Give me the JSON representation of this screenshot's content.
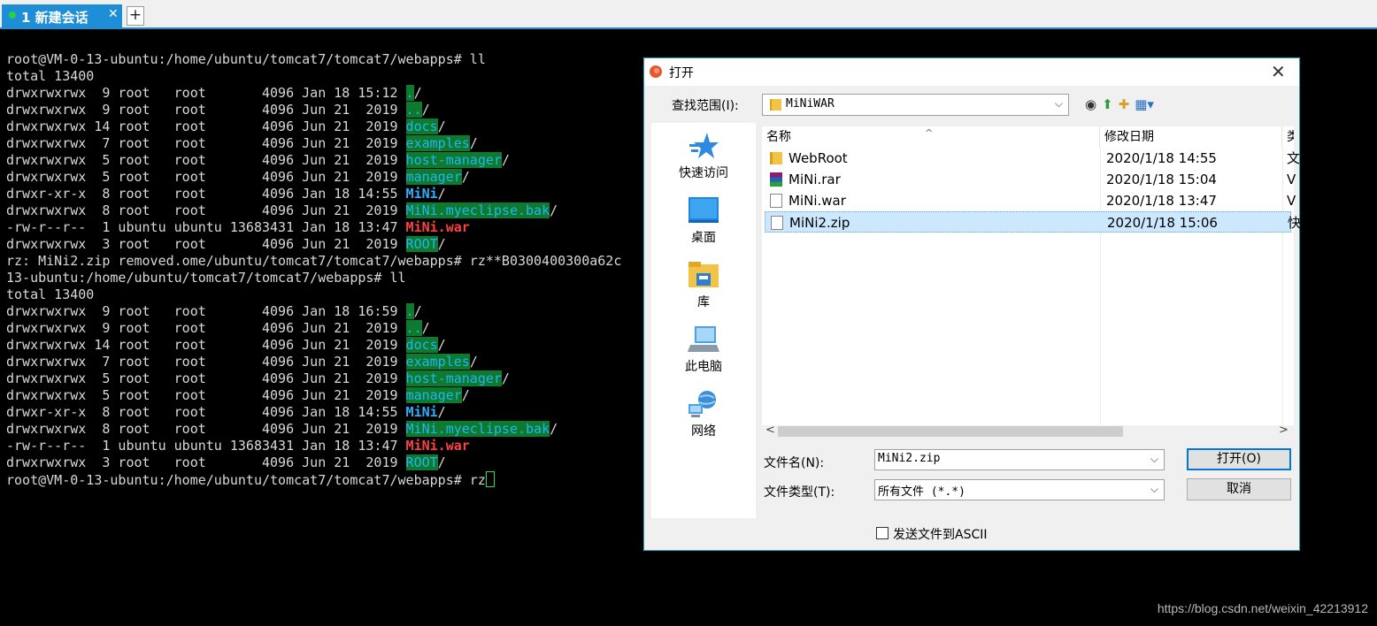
{
  "tabs": [
    {
      "label": "1 新建会话",
      "close": "✕"
    }
  ],
  "new_tab_label": "+",
  "terminal": {
    "lines": [
      {
        "parts": [
          {
            "t": "root@VM-0-13-ubuntu:/home/ubuntu/tomcat7/tomcat7/webapps# ll"
          }
        ]
      },
      {
        "parts": [
          {
            "t": "total 13400"
          }
        ]
      },
      {
        "parts": [
          {
            "t": "drwxrwxrwx  9 root   root       4096 Jan 18 15:12 "
          },
          {
            "t": ".",
            "c": "dirhl"
          },
          {
            "t": "/"
          }
        ]
      },
      {
        "parts": [
          {
            "t": "drwxrwxrwx  9 root   root       4096 Jun 21  2019 "
          },
          {
            "t": "..",
            "c": "dirhl"
          },
          {
            "t": "/"
          }
        ]
      },
      {
        "parts": [
          {
            "t": "drwxrwxrwx 14 root   root       4096 Jun 21  2019 "
          },
          {
            "t": "docs",
            "c": "dirhl"
          },
          {
            "t": "/"
          }
        ]
      },
      {
        "parts": [
          {
            "t": "drwxrwxrwx  7 root   root       4096 Jun 21  2019 "
          },
          {
            "t": "examples",
            "c": "dirhl"
          },
          {
            "t": "/"
          }
        ]
      },
      {
        "parts": [
          {
            "t": "drwxrwxrwx  5 root   root       4096 Jun 21  2019 "
          },
          {
            "t": "host-manager",
            "c": "dirhl"
          },
          {
            "t": "/"
          }
        ]
      },
      {
        "parts": [
          {
            "t": "drwxrwxrwx  5 root   root       4096 Jun 21  2019 "
          },
          {
            "t": "manager",
            "c": "dirhl"
          },
          {
            "t": "/"
          }
        ]
      },
      {
        "parts": [
          {
            "t": "drwxr-xr-x  8 root   root       4096 Jan 18 14:55 "
          },
          {
            "t": "MiNi",
            "c": "bold-blue"
          },
          {
            "t": "/"
          }
        ]
      },
      {
        "parts": [
          {
            "t": "drwxrwxrwx  8 root   root       4096 Jun 21  2019 "
          },
          {
            "t": "MiNi.myeclipse.bak",
            "c": "dirhl"
          },
          {
            "t": "/"
          }
        ]
      },
      {
        "parts": [
          {
            "t": "-rw-r--r--  1 ubuntu ubuntu 13683431 Jan 18 13:47 "
          },
          {
            "t": "MiNi.war",
            "c": "bold-red"
          }
        ]
      },
      {
        "parts": [
          {
            "t": "drwxrwxrwx  3 root   root       4096 Jun 21  2019 "
          },
          {
            "t": "ROOT",
            "c": "dirhl"
          },
          {
            "t": "/"
          }
        ]
      },
      {
        "parts": [
          {
            "t": "rz: MiNi2.zip removed.ome/ubuntu/tomcat7/tomcat7/webapps# rz**B0300400300a62c"
          }
        ]
      },
      {
        "parts": [
          {
            "t": "13-ubuntu:/home/ubuntu/tomcat7/tomcat7/webapps# ll"
          }
        ]
      },
      {
        "parts": [
          {
            "t": "total 13400"
          }
        ]
      },
      {
        "parts": [
          {
            "t": "drwxrwxrwx  9 root   root       4096 Jan 18 16:59 "
          },
          {
            "t": ".",
            "c": "dirhl"
          },
          {
            "t": "/"
          }
        ]
      },
      {
        "parts": [
          {
            "t": "drwxrwxrwx  9 root   root       4096 Jun 21  2019 "
          },
          {
            "t": "..",
            "c": "dirhl"
          },
          {
            "t": "/"
          }
        ]
      },
      {
        "parts": [
          {
            "t": "drwxrwxrwx 14 root   root       4096 Jun 21  2019 "
          },
          {
            "t": "docs",
            "c": "dirhl"
          },
          {
            "t": "/"
          }
        ]
      },
      {
        "parts": [
          {
            "t": "drwxrwxrwx  7 root   root       4096 Jun 21  2019 "
          },
          {
            "t": "examples",
            "c": "dirhl"
          },
          {
            "t": "/"
          }
        ]
      },
      {
        "parts": [
          {
            "t": "drwxrwxrwx  5 root   root       4096 Jun 21  2019 "
          },
          {
            "t": "host-manager",
            "c": "dirhl"
          },
          {
            "t": "/"
          }
        ]
      },
      {
        "parts": [
          {
            "t": "drwxrwxrwx  5 root   root       4096 Jun 21  2019 "
          },
          {
            "t": "manager",
            "c": "dirhl"
          },
          {
            "t": "/"
          }
        ]
      },
      {
        "parts": [
          {
            "t": "drwxr-xr-x  8 root   root       4096 Jan 18 14:55 "
          },
          {
            "t": "MiNi",
            "c": "bold-blue"
          },
          {
            "t": "/"
          }
        ]
      },
      {
        "parts": [
          {
            "t": "drwxrwxrwx  8 root   root       4096 Jun 21  2019 "
          },
          {
            "t": "MiNi.myeclipse.bak",
            "c": "dirhl"
          },
          {
            "t": "/"
          }
        ]
      },
      {
        "parts": [
          {
            "t": "-rw-r--r--  1 ubuntu ubuntu 13683431 Jan 18 13:47 "
          },
          {
            "t": "MiNi.war",
            "c": "bold-red"
          }
        ]
      },
      {
        "parts": [
          {
            "t": "drwxrwxrwx  3 root   root       4096 Jun 21  2019 "
          },
          {
            "t": "ROOT",
            "c": "dirhl"
          },
          {
            "t": "/"
          }
        ]
      },
      {
        "parts": [
          {
            "t": "root@VM-0-13-ubuntu:/home/ubuntu/tomcat7/tomcat7/webapps# rz"
          }
        ],
        "cursor": true
      }
    ]
  },
  "watermark": "https://blog.csdn.net/weixin_42213912",
  "dialog": {
    "title": "打开",
    "close": "✕",
    "look_in_label": "查找范围(I):",
    "look_in_value": "MiNiWAR",
    "places": [
      {
        "label": "快速访问",
        "icon": "star-icon"
      },
      {
        "label": "桌面",
        "icon": "desktop-icon"
      },
      {
        "label": "库",
        "icon": "library-icon"
      },
      {
        "label": "此电脑",
        "icon": "computer-icon"
      },
      {
        "label": "网络",
        "icon": "network-icon"
      }
    ],
    "columns": {
      "name": "名称",
      "date": "修改日期",
      "type": "类"
    },
    "files": [
      {
        "name": "WebRoot",
        "date": "2020/1/18 14:55",
        "type": "文",
        "icon": "folder",
        "selected": false
      },
      {
        "name": "MiNi.rar",
        "date": "2020/1/18 15:04",
        "type": "V",
        "icon": "rar",
        "selected": false
      },
      {
        "name": "MiNi.war",
        "date": "2020/1/18 13:47",
        "type": "V",
        "icon": "doc",
        "selected": false
      },
      {
        "name": "MiNi2.zip",
        "date": "2020/1/18 15:06",
        "type": "快",
        "icon": "doc",
        "selected": true
      }
    ],
    "filename_label": "文件名(N):",
    "filename_value": "MiNi2.zip",
    "filetype_label": "文件类型(T):",
    "filetype_value": "所有文件 (*.*)",
    "open_button": "打开(O)",
    "cancel_button": "取消",
    "ascii_checkbox_label": "发送文件到ASCII",
    "ascii_checked": false,
    "combo_arrow": "⌵",
    "scroll_left": "<",
    "scroll_right": ">",
    "sort_indicator": "^"
  }
}
